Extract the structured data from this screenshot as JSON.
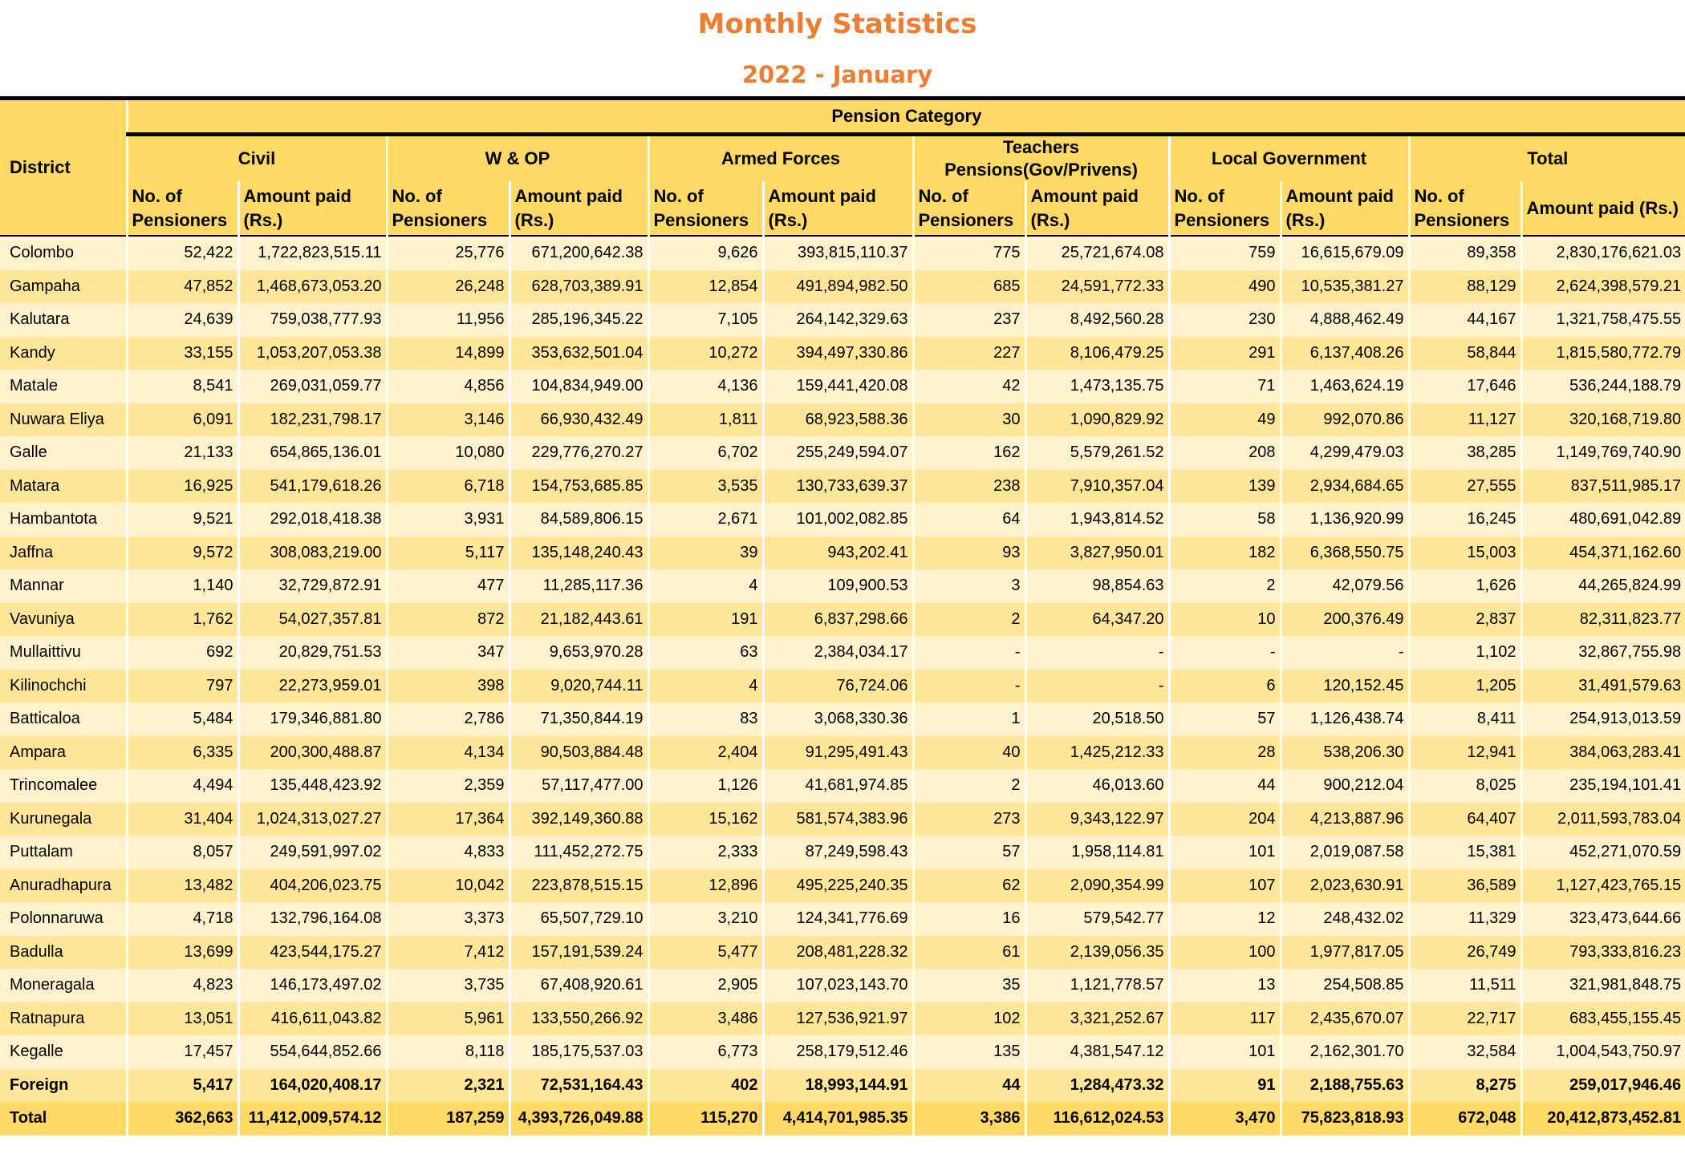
{
  "title": "Monthly Statistics",
  "subtitle": "2022 - January",
  "header": {
    "district": "District",
    "pension_category": "Pension Category",
    "groups": [
      "Civil",
      "W & OP",
      "Armed Forces",
      "Teachers Pensions(Gov/Privens)",
      "Local Government",
      "Total"
    ],
    "col_no": "No. of Pensioners",
    "col_amount": "Amount paid (Rs.)",
    "col_amount_total": "Amount paid (Rs.)"
  },
  "rows": [
    {
      "district": "Colombo",
      "values": [
        "52,422",
        "1,722,823,515.11",
        "25,776",
        "671,200,642.38",
        "9,626",
        "393,815,110.37",
        "775",
        "25,721,674.08",
        "759",
        "16,615,679.09",
        "89,358",
        "2,830,176,621.03"
      ]
    },
    {
      "district": "Gampaha",
      "values": [
        "47,852",
        "1,468,673,053.20",
        "26,248",
        "628,703,389.91",
        "12,854",
        "491,894,982.50",
        "685",
        "24,591,772.33",
        "490",
        "10,535,381.27",
        "88,129",
        "2,624,398,579.21"
      ]
    },
    {
      "district": "Kalutara",
      "values": [
        "24,639",
        "759,038,777.93",
        "11,956",
        "285,196,345.22",
        "7,105",
        "264,142,329.63",
        "237",
        "8,492,560.28",
        "230",
        "4,888,462.49",
        "44,167",
        "1,321,758,475.55"
      ]
    },
    {
      "district": "Kandy",
      "values": [
        "33,155",
        "1,053,207,053.38",
        "14,899",
        "353,632,501.04",
        "10,272",
        "394,497,330.86",
        "227",
        "8,106,479.25",
        "291",
        "6,137,408.26",
        "58,844",
        "1,815,580,772.79"
      ]
    },
    {
      "district": "Matale",
      "values": [
        "8,541",
        "269,031,059.77",
        "4,856",
        "104,834,949.00",
        "4,136",
        "159,441,420.08",
        "42",
        "1,473,135.75",
        "71",
        "1,463,624.19",
        "17,646",
        "536,244,188.79"
      ]
    },
    {
      "district": "Nuwara Eliya",
      "values": [
        "6,091",
        "182,231,798.17",
        "3,146",
        "66,930,432.49",
        "1,811",
        "68,923,588.36",
        "30",
        "1,090,829.92",
        "49",
        "992,070.86",
        "11,127",
        "320,168,719.80"
      ]
    },
    {
      "district": "Galle",
      "values": [
        "21,133",
        "654,865,136.01",
        "10,080",
        "229,776,270.27",
        "6,702",
        "255,249,594.07",
        "162",
        "5,579,261.52",
        "208",
        "4,299,479.03",
        "38,285",
        "1,149,769,740.90"
      ]
    },
    {
      "district": "Matara",
      "values": [
        "16,925",
        "541,179,618.26",
        "6,718",
        "154,753,685.85",
        "3,535",
        "130,733,639.37",
        "238",
        "7,910,357.04",
        "139",
        "2,934,684.65",
        "27,555",
        "837,511,985.17"
      ]
    },
    {
      "district": "Hambantota",
      "values": [
        "9,521",
        "292,018,418.38",
        "3,931",
        "84,589,806.15",
        "2,671",
        "101,002,082.85",
        "64",
        "1,943,814.52",
        "58",
        "1,136,920.99",
        "16,245",
        "480,691,042.89"
      ]
    },
    {
      "district": "Jaffna",
      "values": [
        "9,572",
        "308,083,219.00",
        "5,117",
        "135,148,240.43",
        "39",
        "943,202.41",
        "93",
        "3,827,950.01",
        "182",
        "6,368,550.75",
        "15,003",
        "454,371,162.60"
      ]
    },
    {
      "district": "Mannar",
      "values": [
        "1,140",
        "32,729,872.91",
        "477",
        "11,285,117.36",
        "4",
        "109,900.53",
        "3",
        "98,854.63",
        "2",
        "42,079.56",
        "1,626",
        "44,265,824.99"
      ]
    },
    {
      "district": "Vavuniya",
      "values": [
        "1,762",
        "54,027,357.81",
        "872",
        "21,182,443.61",
        "191",
        "6,837,298.66",
        "2",
        "64,347.20",
        "10",
        "200,376.49",
        "2,837",
        "82,311,823.77"
      ]
    },
    {
      "district": "Mullaittivu",
      "values": [
        "692",
        "20,829,751.53",
        "347",
        "9,653,970.28",
        "63",
        "2,384,034.17",
        "-",
        "-",
        "-",
        "-",
        "1,102",
        "32,867,755.98"
      ]
    },
    {
      "district": "Kilinochchi",
      "values": [
        "797",
        "22,273,959.01",
        "398",
        "9,020,744.11",
        "4",
        "76,724.06",
        "-",
        "-",
        "6",
        "120,152.45",
        "1,205",
        "31,491,579.63"
      ]
    },
    {
      "district": "Batticaloa",
      "values": [
        "5,484",
        "179,346,881.80",
        "2,786",
        "71,350,844.19",
        "83",
        "3,068,330.36",
        "1",
        "20,518.50",
        "57",
        "1,126,438.74",
        "8,411",
        "254,913,013.59"
      ]
    },
    {
      "district": "Ampara",
      "values": [
        "6,335",
        "200,300,488.87",
        "4,134",
        "90,503,884.48",
        "2,404",
        "91,295,491.43",
        "40",
        "1,425,212.33",
        "28",
        "538,206.30",
        "12,941",
        "384,063,283.41"
      ]
    },
    {
      "district": "Trincomalee",
      "values": [
        "4,494",
        "135,448,423.92",
        "2,359",
        "57,117,477.00",
        "1,126",
        "41,681,974.85",
        "2",
        "46,013.60",
        "44",
        "900,212.04",
        "8,025",
        "235,194,101.41"
      ]
    },
    {
      "district": "Kurunegala",
      "values": [
        "31,404",
        "1,024,313,027.27",
        "17,364",
        "392,149,360.88",
        "15,162",
        "581,574,383.96",
        "273",
        "9,343,122.97",
        "204",
        "4,213,887.96",
        "64,407",
        "2,011,593,783.04"
      ]
    },
    {
      "district": "Puttalam",
      "values": [
        "8,057",
        "249,591,997.02",
        "4,833",
        "111,452,272.75",
        "2,333",
        "87,249,598.43",
        "57",
        "1,958,114.81",
        "101",
        "2,019,087.58",
        "15,381",
        "452,271,070.59"
      ]
    },
    {
      "district": "Anuradhapura",
      "values": [
        "13,482",
        "404,206,023.75",
        "10,042",
        "223,878,515.15",
        "12,896",
        "495,225,240.35",
        "62",
        "2,090,354.99",
        "107",
        "2,023,630.91",
        "36,589",
        "1,127,423,765.15"
      ]
    },
    {
      "district": "Polonnaruwa",
      "values": [
        "4,718",
        "132,796,164.08",
        "3,373",
        "65,507,729.10",
        "3,210",
        "124,341,776.69",
        "16",
        "579,542.77",
        "12",
        "248,432.02",
        "11,329",
        "323,473,644.66"
      ]
    },
    {
      "district": "Badulla",
      "values": [
        "13,699",
        "423,544,175.27",
        "7,412",
        "157,191,539.24",
        "5,477",
        "208,481,228.32",
        "61",
        "2,139,056.35",
        "100",
        "1,977,817.05",
        "26,749",
        "793,333,816.23"
      ]
    },
    {
      "district": "Moneragala",
      "values": [
        "4,823",
        "146,173,497.02",
        "3,735",
        "67,408,920.61",
        "2,905",
        "107,023,143.70",
        "35",
        "1,121,778.57",
        "13",
        "254,508.85",
        "11,511",
        "321,981,848.75"
      ]
    },
    {
      "district": "Ratnapura",
      "values": [
        "13,051",
        "416,611,043.82",
        "5,961",
        "133,550,266.92",
        "3,486",
        "127,536,921.97",
        "102",
        "3,321,252.67",
        "117",
        "2,435,670.07",
        "22,717",
        "683,455,155.45"
      ]
    },
    {
      "district": "Kegalle",
      "values": [
        "17,457",
        "554,644,852.66",
        "8,118",
        "185,175,537.03",
        "6,773",
        "258,179,512.46",
        "135",
        "4,381,547.12",
        "101",
        "2,162,301.70",
        "32,584",
        "1,004,543,750.97"
      ]
    },
    {
      "district": "Foreign",
      "values": [
        "5,417",
        "164,020,408.17",
        "2,321",
        "72,531,164.43",
        "402",
        "18,993,144.91",
        "44",
        "1,284,473.32",
        "91",
        "2,188,755.63",
        "8,275",
        "259,017,946.46"
      ]
    },
    {
      "district": "Total",
      "values": [
        "362,663",
        "11,412,009,574.12",
        "187,259",
        "4,393,726,049.88",
        "115,270",
        "4,414,701,985.35",
        "3,386",
        "116,612,024.53",
        "3,470",
        "75,823,818.93",
        "672,048",
        "20,412,873,452.81"
      ]
    }
  ],
  "colors": {
    "title": "#ED7D31",
    "header_bg": "#FFD966",
    "row_light": "#FFF2CC",
    "row_dark": "#FFE699"
  }
}
